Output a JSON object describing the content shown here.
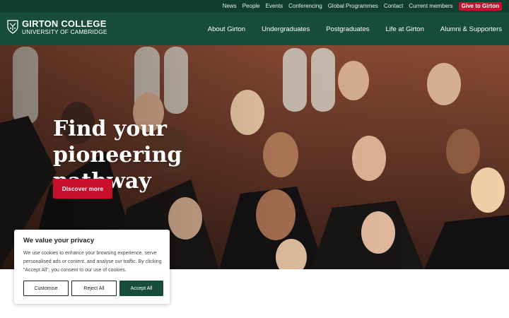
{
  "topbar": {
    "links": [
      "News",
      "People",
      "Events",
      "Conferencing",
      "Global Programmes",
      "Contact",
      "Current members"
    ],
    "give_label": "Give to Girton"
  },
  "header": {
    "logo_name": "GIRTON COLLEGE",
    "logo_sub": "UNIVERSITY OF CAMBRIDGE",
    "nav": [
      "About Girton",
      "Undergraduates",
      "Postgraduates",
      "Life at Girton",
      "Alumni & Supporters"
    ]
  },
  "hero": {
    "title": "Find your pioneering pathway",
    "cta_label": "Discover more"
  },
  "cookie": {
    "title": "We value your privacy",
    "body": "We use cookies to enhance your browsing experience, serve personalised ads or content, and analyse our traffic. By clicking \"Accept All\", you consent to our use of cookies.",
    "customise_label": "Customise",
    "reject_label": "Reject All",
    "accept_label": "Accept All"
  },
  "colors": {
    "topbar_bg": "#0f3d2e",
    "header_bg": "#184d3a",
    "accent_red": "#c8102e",
    "accept_green": "#184d3a"
  },
  "icons": {
    "logo": "college-crest-icon"
  }
}
